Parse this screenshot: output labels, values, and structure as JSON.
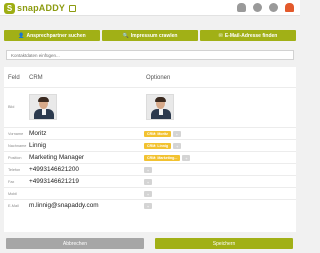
{
  "app": {
    "logo_mark": "S",
    "logo_text": "snapADDY"
  },
  "topbar": {
    "icons": [
      "user-icon",
      "grid-icon",
      "settings-icon",
      "notification-bell-icon"
    ]
  },
  "actions": [
    {
      "label": "Ansprechpartner suchen",
      "icon": "user-icon"
    },
    {
      "label": "Impressum crawlen",
      "icon": "search-icon"
    },
    {
      "label": "E-Mail-Adresse finden",
      "icon": "envelope-icon"
    }
  ],
  "search": {
    "placeholder": "Kontaktdaten einfügen..."
  },
  "table": {
    "headers": {
      "feld": "Feld",
      "crm": "CRM",
      "optionen": "Optionen"
    },
    "rows": [
      {
        "label": "Bild",
        "crm": "",
        "option": ""
      },
      {
        "label": "Vorname",
        "crm": "Moritz",
        "option": "CRM: Moritz"
      },
      {
        "label": "Nachname",
        "crm": "Linnig",
        "option": "CRM: Linnig"
      },
      {
        "label": "Position",
        "crm": "Marketing Manager",
        "option": "CRM: Marketing..."
      },
      {
        "label": "Telefon",
        "crm": "+4993146621200",
        "option": ""
      },
      {
        "label": "Fax",
        "crm": "+4993146621219",
        "option": ""
      },
      {
        "label": "Mobil",
        "crm": "",
        "option": ""
      },
      {
        "label": "E-Mail",
        "crm": "m.linnig@snapaddy.com",
        "option": ""
      }
    ]
  },
  "footer": {
    "cancel": "Abbrechen",
    "save": "Speichern"
  },
  "colors": {
    "accent": "#a1b016",
    "pill": "#f2c230",
    "cancel": "#a6a6a6",
    "bell": "#e35a2c"
  }
}
